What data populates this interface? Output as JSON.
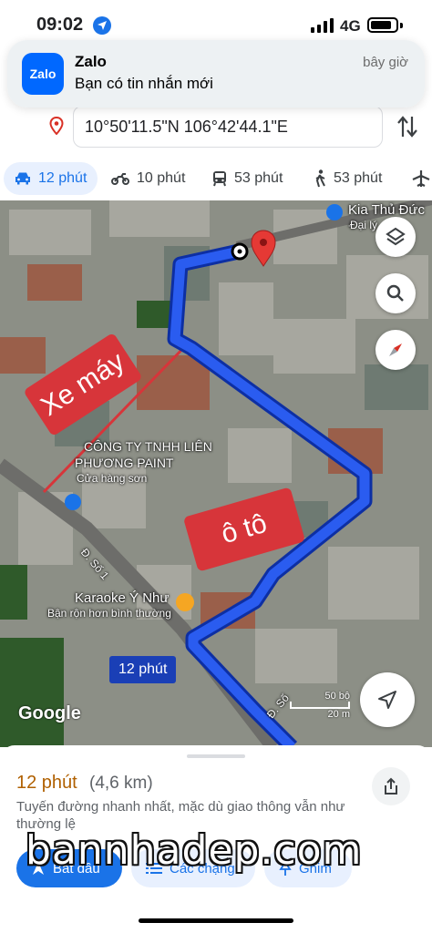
{
  "status_bar": {
    "time": "09:02",
    "network": "4G"
  },
  "notification": {
    "app_icon_text": "Zalo",
    "app_name": "Zalo",
    "message": "Bạn có tin nhắn mới",
    "time": "bây giờ"
  },
  "directions": {
    "destination_value": "10°50'11.5\"N 106°42'44.1\"E",
    "modes": [
      {
        "icon": "car-icon",
        "label": "12 phút",
        "active": true
      },
      {
        "icon": "motorbike-icon",
        "label": "10 phút"
      },
      {
        "icon": "transit-icon",
        "label": "53 phút"
      },
      {
        "icon": "walk-icon",
        "label": "53 phút"
      },
      {
        "icon": "flight-icon",
        "label": ""
      }
    ]
  },
  "map": {
    "places": {
      "kia": "Kia Thủ Đức -",
      "kia_sub": "Đại lý",
      "company_line1": "CÔNG TY TNHH LIÊN",
      "company_line2": "PHƯƠNG PAINT",
      "company_sub": "Cửa hàng sơn",
      "karaoke": "Karaoke Ý Như",
      "karaoke_sub": "Bận rộn hơn bình thường",
      "street_1": "Đ. Số 1",
      "street_2": "Đ. Số"
    },
    "annotation_moto": "Xe máy",
    "annotation_car": "ô tô",
    "route_badge": "12 phút",
    "logo": "Google",
    "scale_top": "50 bộ",
    "scale_bottom": "20 m"
  },
  "route_summary": {
    "duration": "12 phút",
    "distance": "(4,6 km)",
    "description": "Tuyến đường nhanh nhất, mặc dù giao thông vẫn như thường lệ"
  },
  "actions": {
    "start": "Bắt đầu",
    "steps": "Các chặng",
    "pin": "Ghim"
  },
  "watermark": "bannhadep.com",
  "colors": {
    "accent": "#1a73e8",
    "route": "#1f4fe0",
    "annotation": "#d7353a",
    "duration": "#b06000"
  }
}
